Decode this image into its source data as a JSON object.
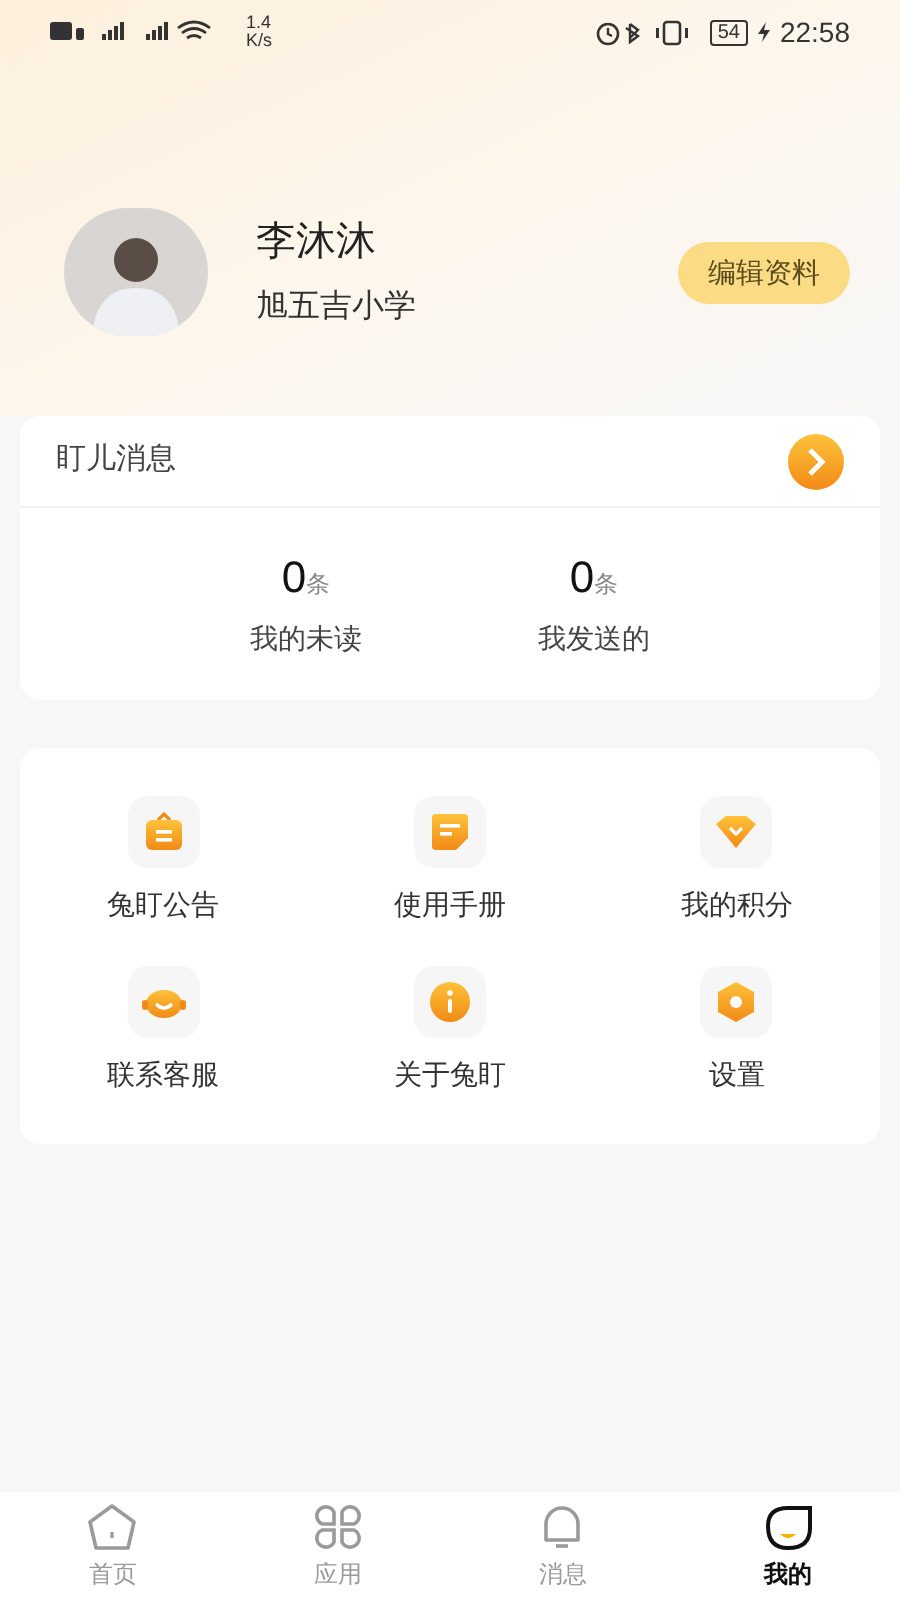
{
  "status_bar": {
    "speed": "1.4",
    "speed_unit": "K/s",
    "battery": "54",
    "time": "22:58"
  },
  "profile": {
    "name": "李沐沐",
    "school": "旭五吉小学",
    "edit_button": "编辑资料"
  },
  "messages": {
    "title": "盯儿消息",
    "stats": [
      {
        "count": "0",
        "unit": "条",
        "label": "我的未读"
      },
      {
        "count": "0",
        "unit": "条",
        "label": "我发送的"
      }
    ]
  },
  "menu": [
    {
      "kind": "notice",
      "label": "兔盯公告"
    },
    {
      "kind": "manual",
      "label": "使用手册"
    },
    {
      "kind": "points",
      "label": "我的积分"
    },
    {
      "kind": "support",
      "label": "联系客服"
    },
    {
      "kind": "about",
      "label": "关于兔盯"
    },
    {
      "kind": "settings",
      "label": "设置"
    }
  ],
  "tabs": [
    {
      "kind": "home",
      "label": "首页",
      "selected": false
    },
    {
      "kind": "apps",
      "label": "应用",
      "selected": false
    },
    {
      "kind": "bell",
      "label": "消息",
      "selected": false
    },
    {
      "kind": "me",
      "label": "我的",
      "selected": true
    }
  ]
}
